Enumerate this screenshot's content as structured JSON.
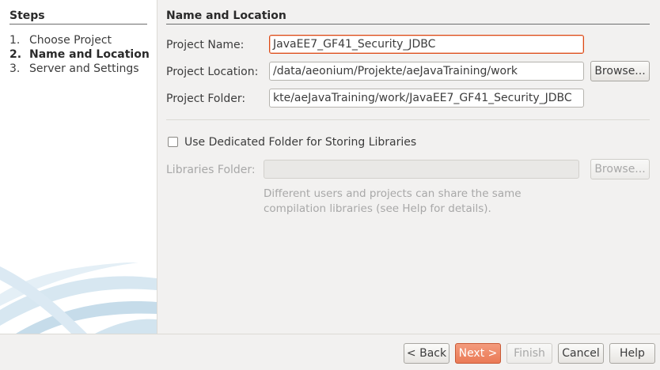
{
  "steps": {
    "title": "Steps",
    "items": [
      {
        "num": "1.",
        "label": "Choose Project"
      },
      {
        "num": "2.",
        "label": "Name and Location"
      },
      {
        "num": "3.",
        "label": "Server and Settings"
      }
    ]
  },
  "section": {
    "title": "Name and Location"
  },
  "project_name": {
    "label": "Project Name:",
    "value": "JavaEE7_GF41_Security_JDBC"
  },
  "project_location": {
    "label": "Project Location:",
    "value": "/data/aeonium/Projekte/aeJavaTraining/work",
    "browse": "Browse..."
  },
  "project_folder": {
    "label": "Project Folder:",
    "value": "kte/aeJavaTraining/work/JavaEE7_GF41_Security_JDBC"
  },
  "dedicated_folder": {
    "label": "Use Dedicated Folder for Storing Libraries",
    "checked": false
  },
  "libraries_folder": {
    "label": "Libraries Folder:",
    "value": "",
    "browse": "Browse...",
    "help": "Different users and projects can share the same compilation libraries (see Help for details)."
  },
  "buttons": {
    "back": "< Back",
    "next": "Next >",
    "finish": "Finish",
    "cancel": "Cancel",
    "help": "Help"
  },
  "colors": {
    "focus": "#dd4814",
    "primary_button": "#ea7a56"
  }
}
